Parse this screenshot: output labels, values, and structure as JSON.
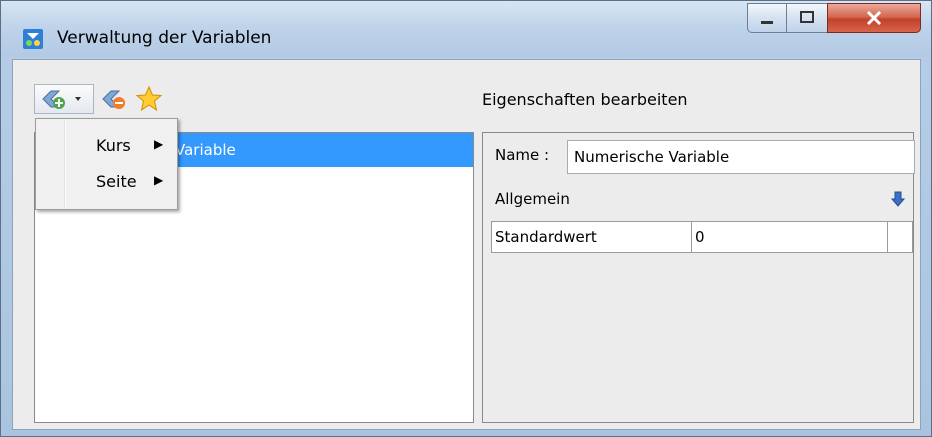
{
  "window": {
    "title": "Verwaltung der Variablen",
    "icon": "variable-app-icon",
    "controls": [
      "minimize-icon",
      "maximize-icon",
      "close-icon"
    ]
  },
  "toolbar": {
    "icons": [
      "add-variable-icon",
      "delete-variable-icon",
      "favorite-star-icon"
    ]
  },
  "variable_list": {
    "selected_item": "Variable"
  },
  "add_menu": {
    "items": [
      {
        "label": "Kurs",
        "arrow": "▶"
      },
      {
        "label": "Seite",
        "arrow": "▶"
      }
    ]
  },
  "properties": {
    "section_title": "Eigenschaften bearbeiten",
    "name_label": "Name :",
    "name_value": "Numerische Variable",
    "group_label": "Allgemein",
    "rows": [
      {
        "key": "Standardwert",
        "value": "0"
      }
    ]
  },
  "colors": {
    "selection": "#3399ff",
    "close_button": "#c8432c",
    "title_gradient": "#bfd3ea"
  }
}
